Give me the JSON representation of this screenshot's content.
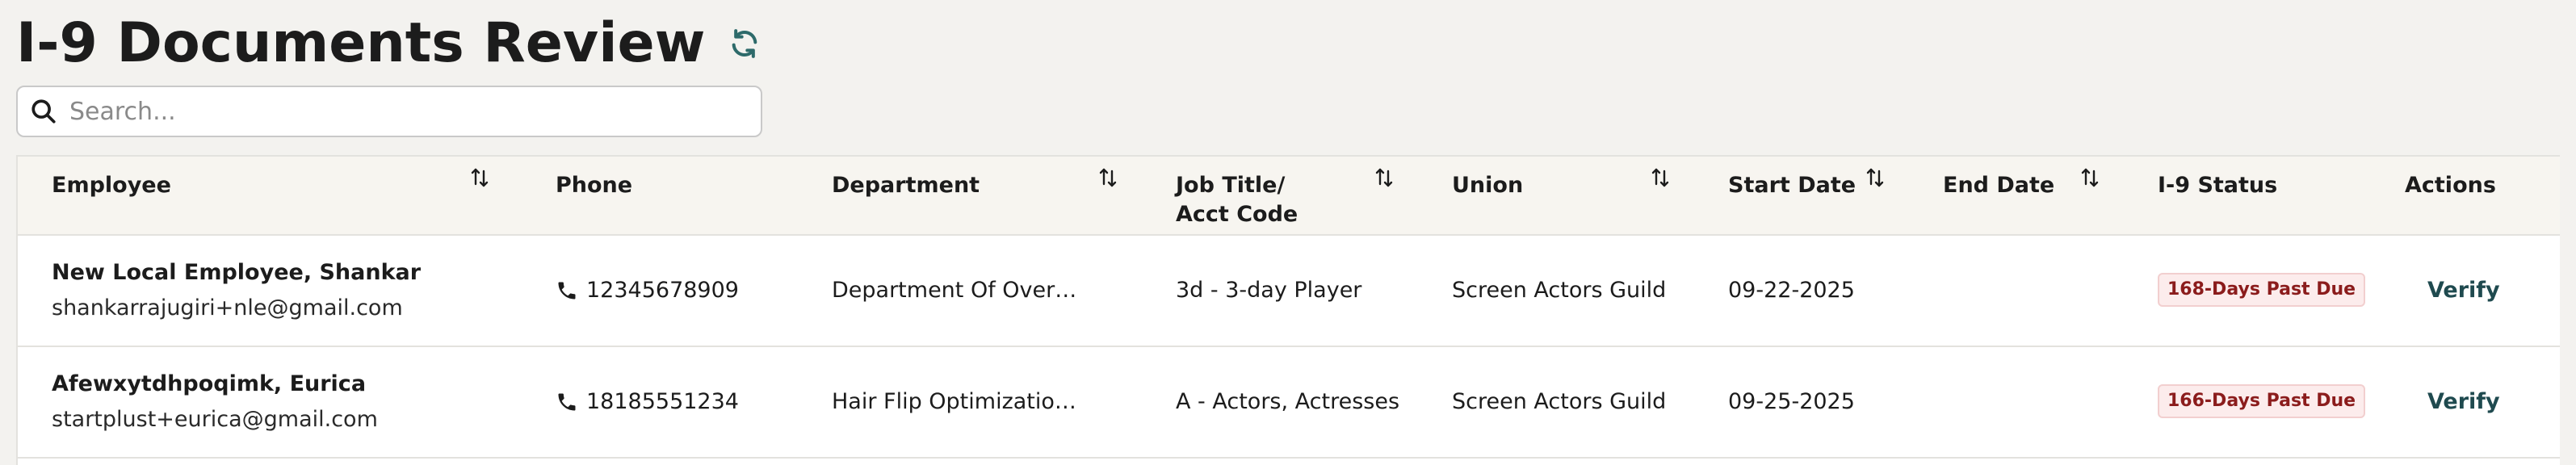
{
  "page": {
    "title": "I-9 Documents Review"
  },
  "search": {
    "placeholder": "Search..."
  },
  "table": {
    "columns": {
      "employee": "Employee",
      "phone": "Phone",
      "department": "Department",
      "job_title_line1": "Job Title/",
      "job_title_line2": "Acct Code",
      "union": "Union",
      "start_date": "Start Date",
      "end_date": "End Date",
      "status": "I-9 Status",
      "actions": "Actions"
    },
    "rows": [
      {
        "name": "New Local Employee, Shankar",
        "email": "shankarrajugiri+nle@gmail.com",
        "phone": "12345678909",
        "department": "Department Of Over…",
        "job_title": "3d - 3-day Player",
        "union": "Screen Actors Guild",
        "start_date": "09-22-2025",
        "end_date": "",
        "status": "168-Days Past Due",
        "action": "Verify"
      },
      {
        "name": "Afewxytdhpoqimk, Eurica",
        "email": "startplust+eurica@gmail.com",
        "phone": "18185551234",
        "department": "Hair Flip Optimizatio…",
        "job_title": "A - Actors, Actresses",
        "union": "Screen Actors Guild",
        "start_date": "09-25-2025",
        "end_date": "",
        "status": "166-Days Past Due",
        "action": "Verify"
      }
    ]
  },
  "colors": {
    "accent": "#2d6a6a",
    "badge_text": "#8b1c1c",
    "badge_bg": "#fcecec",
    "header_bg": "#f7f5f0"
  }
}
